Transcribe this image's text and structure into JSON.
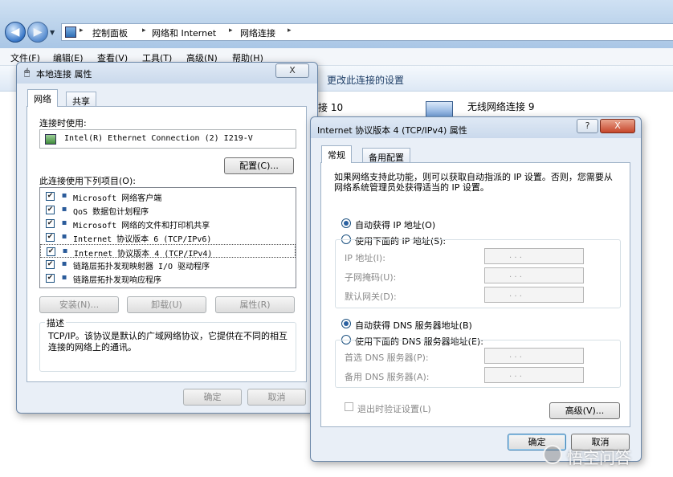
{
  "explorer": {
    "breadcrumb": [
      "控制面板",
      "网络和 Internet",
      "网络连接"
    ],
    "menu": [
      "文件(F)",
      "编辑(E)",
      "查看(V)",
      "工具(T)",
      "高级(N)",
      "帮助(H)"
    ],
    "command": "更改此连接的设置",
    "items": [
      "接 10",
      "无线网络连接 9"
    ]
  },
  "local_dialog": {
    "title": "本地连接 属性",
    "tabs": [
      "网络",
      "共享"
    ],
    "connect_using_label": "连接时使用:",
    "adapter": "Intel(R) Ethernet Connection (2) I219-V",
    "configure_button": "配置(C)...",
    "items_label": "此连接使用下列项目(O):",
    "items": [
      {
        "label": "Microsoft 网络客户端",
        "checked": true
      },
      {
        "label": "QoS 数据包计划程序",
        "checked": true
      },
      {
        "label": "Microsoft 网络的文件和打印机共享",
        "checked": true
      },
      {
        "label": "Internet 协议版本 6 (TCP/IPv6)",
        "checked": true
      },
      {
        "label": "Internet 协议版本 4 (TCP/IPv4)",
        "checked": true
      },
      {
        "label": "链路层拓扑发现映射器 I/O 驱动程序",
        "checked": true
      },
      {
        "label": "链路层拓扑发现响应程序",
        "checked": true
      }
    ],
    "install_button": "安装(N)...",
    "uninstall_button": "卸载(U)",
    "properties_button": "属性(R)",
    "description_label": "描述",
    "description_text": "TCP/IP。该协议是默认的广域网络协议，它提供在不同的相互连接的网络上的通讯。",
    "ok_button": "确定",
    "cancel_button": "取消",
    "close_glyph": "X"
  },
  "ipv4_dialog": {
    "title": "Internet 协议版本 4 (TCP/IPv4) 属性",
    "help_glyph": "?",
    "close_glyph": "X",
    "tabs": [
      "常规",
      "备用配置"
    ],
    "intro": "如果网络支持此功能，则可以获取自动指派的 IP 设置。否则，您需要从网络系统管理员处获得适当的 IP 设置。",
    "auto_ip": "自动获得 IP 地址(O)",
    "manual_ip": "使用下面的 IP 地址(S):",
    "ip_label": "IP 地址(I):",
    "mask_label": "子网掩码(U):",
    "gateway_label": "默认网关(D):",
    "auto_dns": "自动获得 DNS 服务器地址(B)",
    "manual_dns": "使用下面的 DNS 服务器地址(E):",
    "dns1_label": "首选 DNS 服务器(P):",
    "dns2_label": "备用 DNS 服务器(A):",
    "ip_dots": ".     .     .",
    "validate_label": "退出时验证设置(L)",
    "advanced_button": "高级(V)...",
    "ok_button": "确定",
    "cancel_button": "取消"
  },
  "watermark": "悟空问答"
}
